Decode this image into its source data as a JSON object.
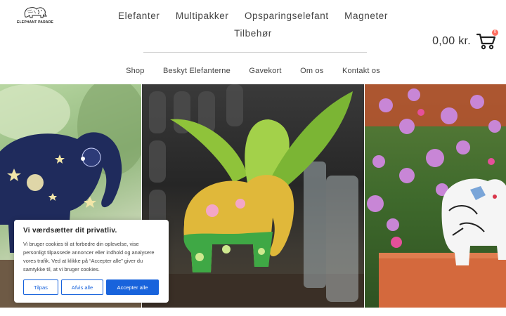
{
  "brand": {
    "logo_text": "ELEPHANT PARADE"
  },
  "main_nav": [
    "Elefanter",
    "Multipakker",
    "Opsparingselefant",
    "Magneter",
    "Tilbehør"
  ],
  "sub_nav": [
    "Shop",
    "Beskyt Elefanterne",
    "Gavekort",
    "Om os",
    "Kontakt os"
  ],
  "cart": {
    "total": "0,00 kr.",
    "count": "0"
  },
  "cookie": {
    "title": "Vi værdsætter dit privatliv.",
    "text": "Vi bruger cookies til at forbedre din oplevelse, vise personligt tilpassede annoncer eller indhold og analysere vores trafik. Ved at klikke på “Accepter alle” giver du samtykke til, at vi bruger cookies.",
    "buttons": {
      "customize": "Tilpas",
      "reject": "Afvis alle",
      "accept": "Accepter alle"
    }
  },
  "colors": {
    "accent": "#1863dc",
    "badge": "#ff6f61"
  }
}
